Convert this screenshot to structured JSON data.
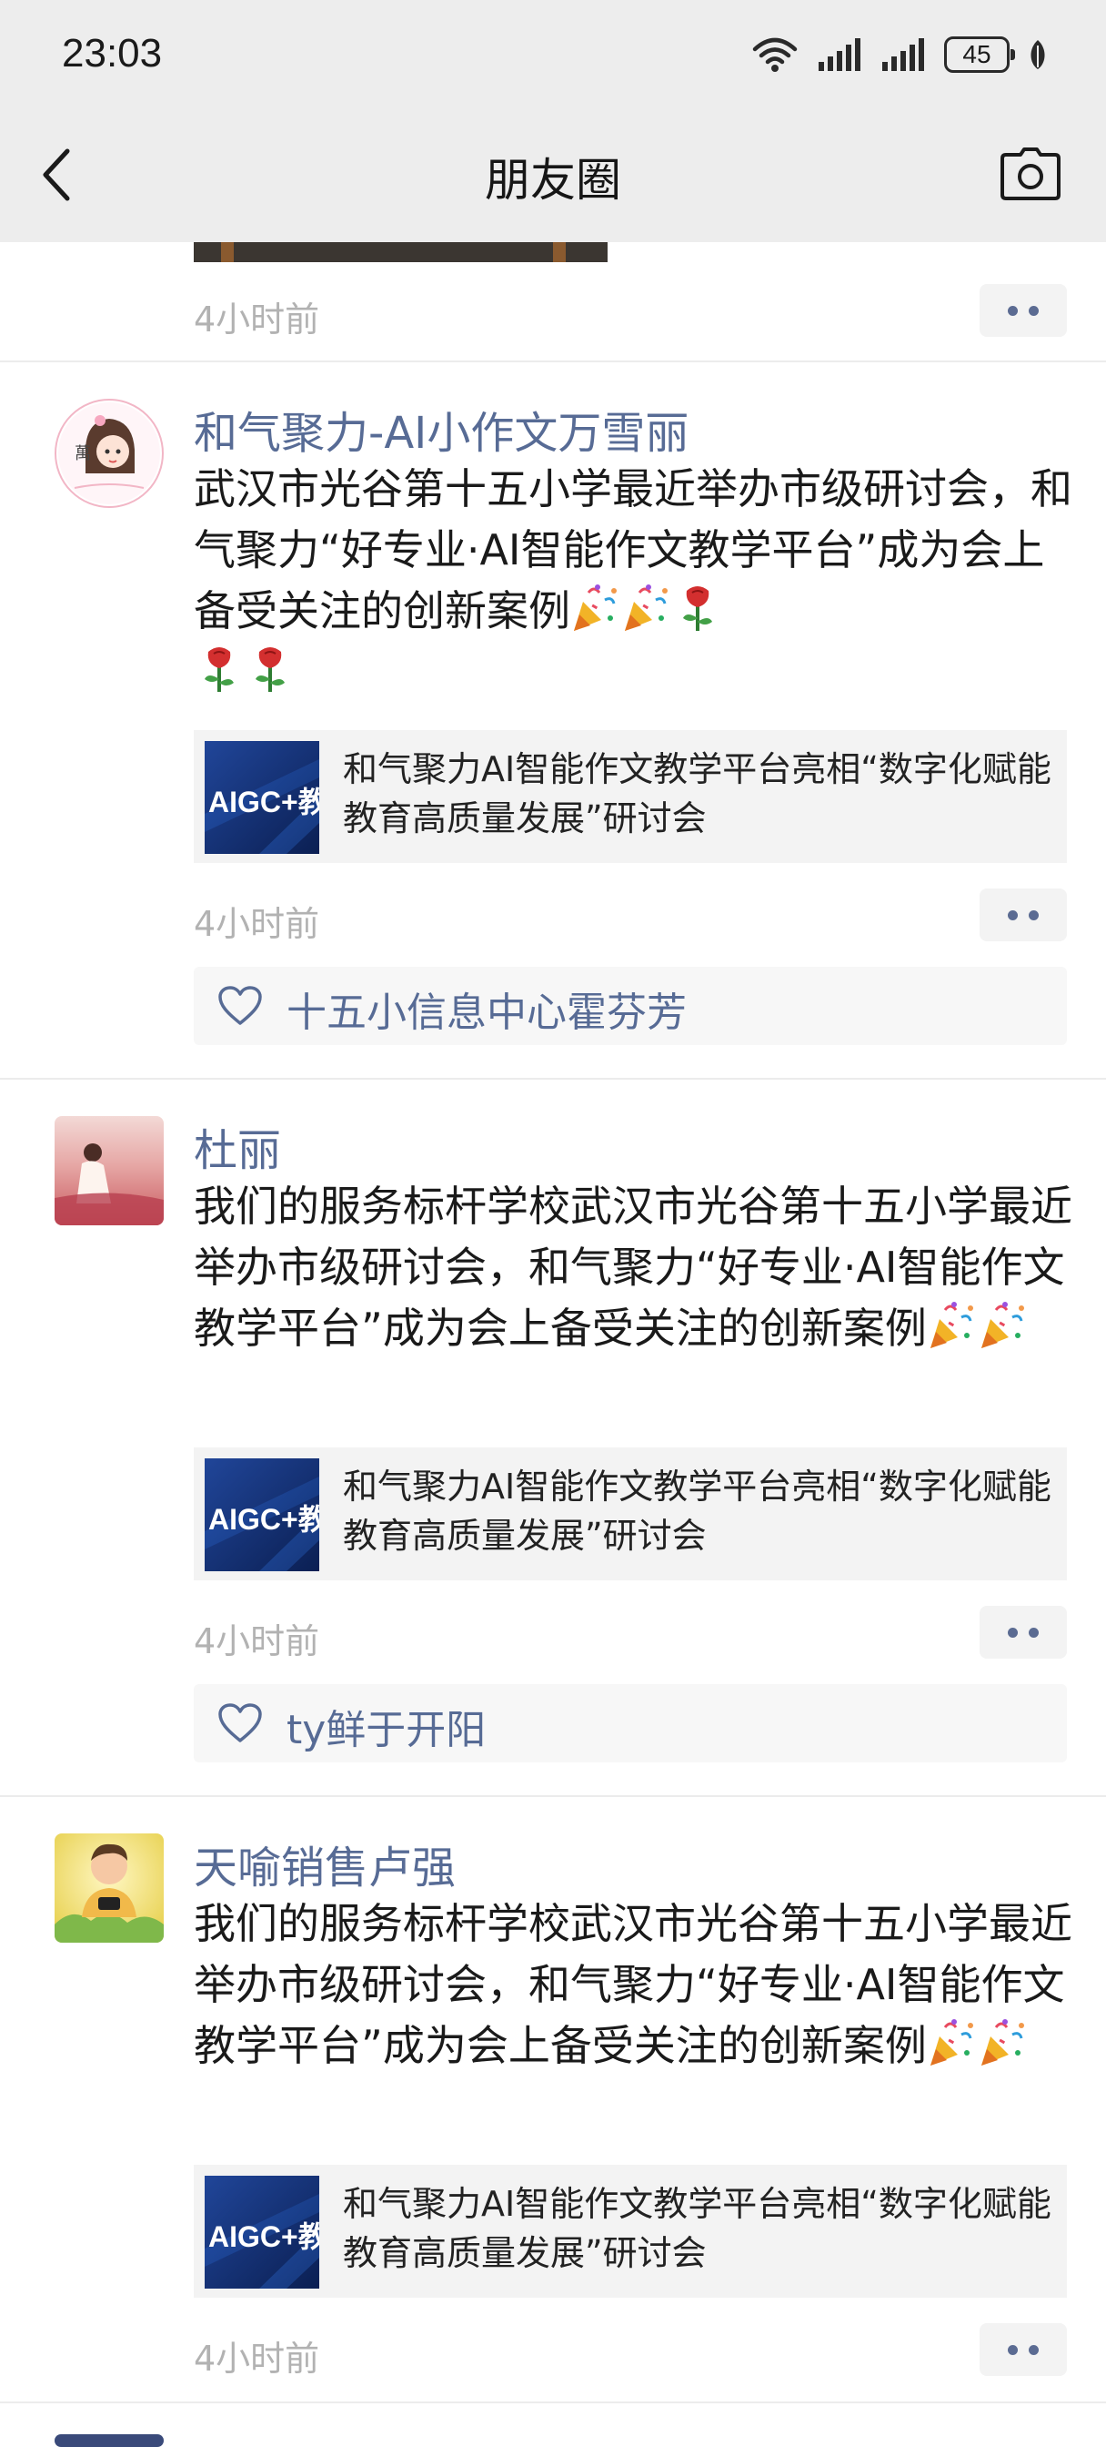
{
  "status": {
    "time": "23:03",
    "battery": "45"
  },
  "nav": {
    "title": "朋友圈"
  },
  "prev_post": {
    "time": "4小时前"
  },
  "posts": [
    {
      "name": "和气聚力-AI小作文万雪丽",
      "text": "武汉市光谷第十五小学最近举办市级研讨会，和气聚力“好专业·AI智能作文教学平台”成为会上备受关注的创新案例",
      "link_title": "和气聚力AI智能作文教学平台亮相“数字化赋能教育高质量发展”研讨会",
      "thumb_text": "AIGC+教",
      "avatar_text": "萬",
      "time": "4小时前",
      "likes": "十五小信息中心霍芬芳"
    },
    {
      "name": "杜丽",
      "text": "我们的服务标杆学校武汉市光谷第十五小学最近举办市级研讨会，和气聚力“好专业·AI智能作文教学平台”成为会上备受关注的创新案例",
      "link_title": "和气聚力AI智能作文教学平台亮相“数字化赋能教育高质量发展”研讨会",
      "thumb_text": "AIGC+教",
      "time": "4小时前",
      "likes": "ty鲜于开阳"
    },
    {
      "name": "天喻销售卢强",
      "text": "我们的服务标杆学校武汉市光谷第十五小学最近举办市级研讨会，和气聚力“好专业·AI智能作文教学平台”成为会上备受关注的创新案例",
      "link_title": "和气聚力AI智能作文教学平台亮相“数字化赋能教育高质量发展”研讨会",
      "thumb_text": "AIGC+教",
      "time": "4小时前"
    }
  ],
  "colors": {
    "link_blue": "#576b95",
    "time_gray": "#b2b2b2",
    "header_bg": "#ededed"
  },
  "icons": [
    "back-arrow-icon",
    "camera-icon",
    "wifi-icon",
    "signal-icon",
    "battery-icon",
    "leaf-icon",
    "heart-icon",
    "party-popper-icon",
    "rose-icon"
  ]
}
